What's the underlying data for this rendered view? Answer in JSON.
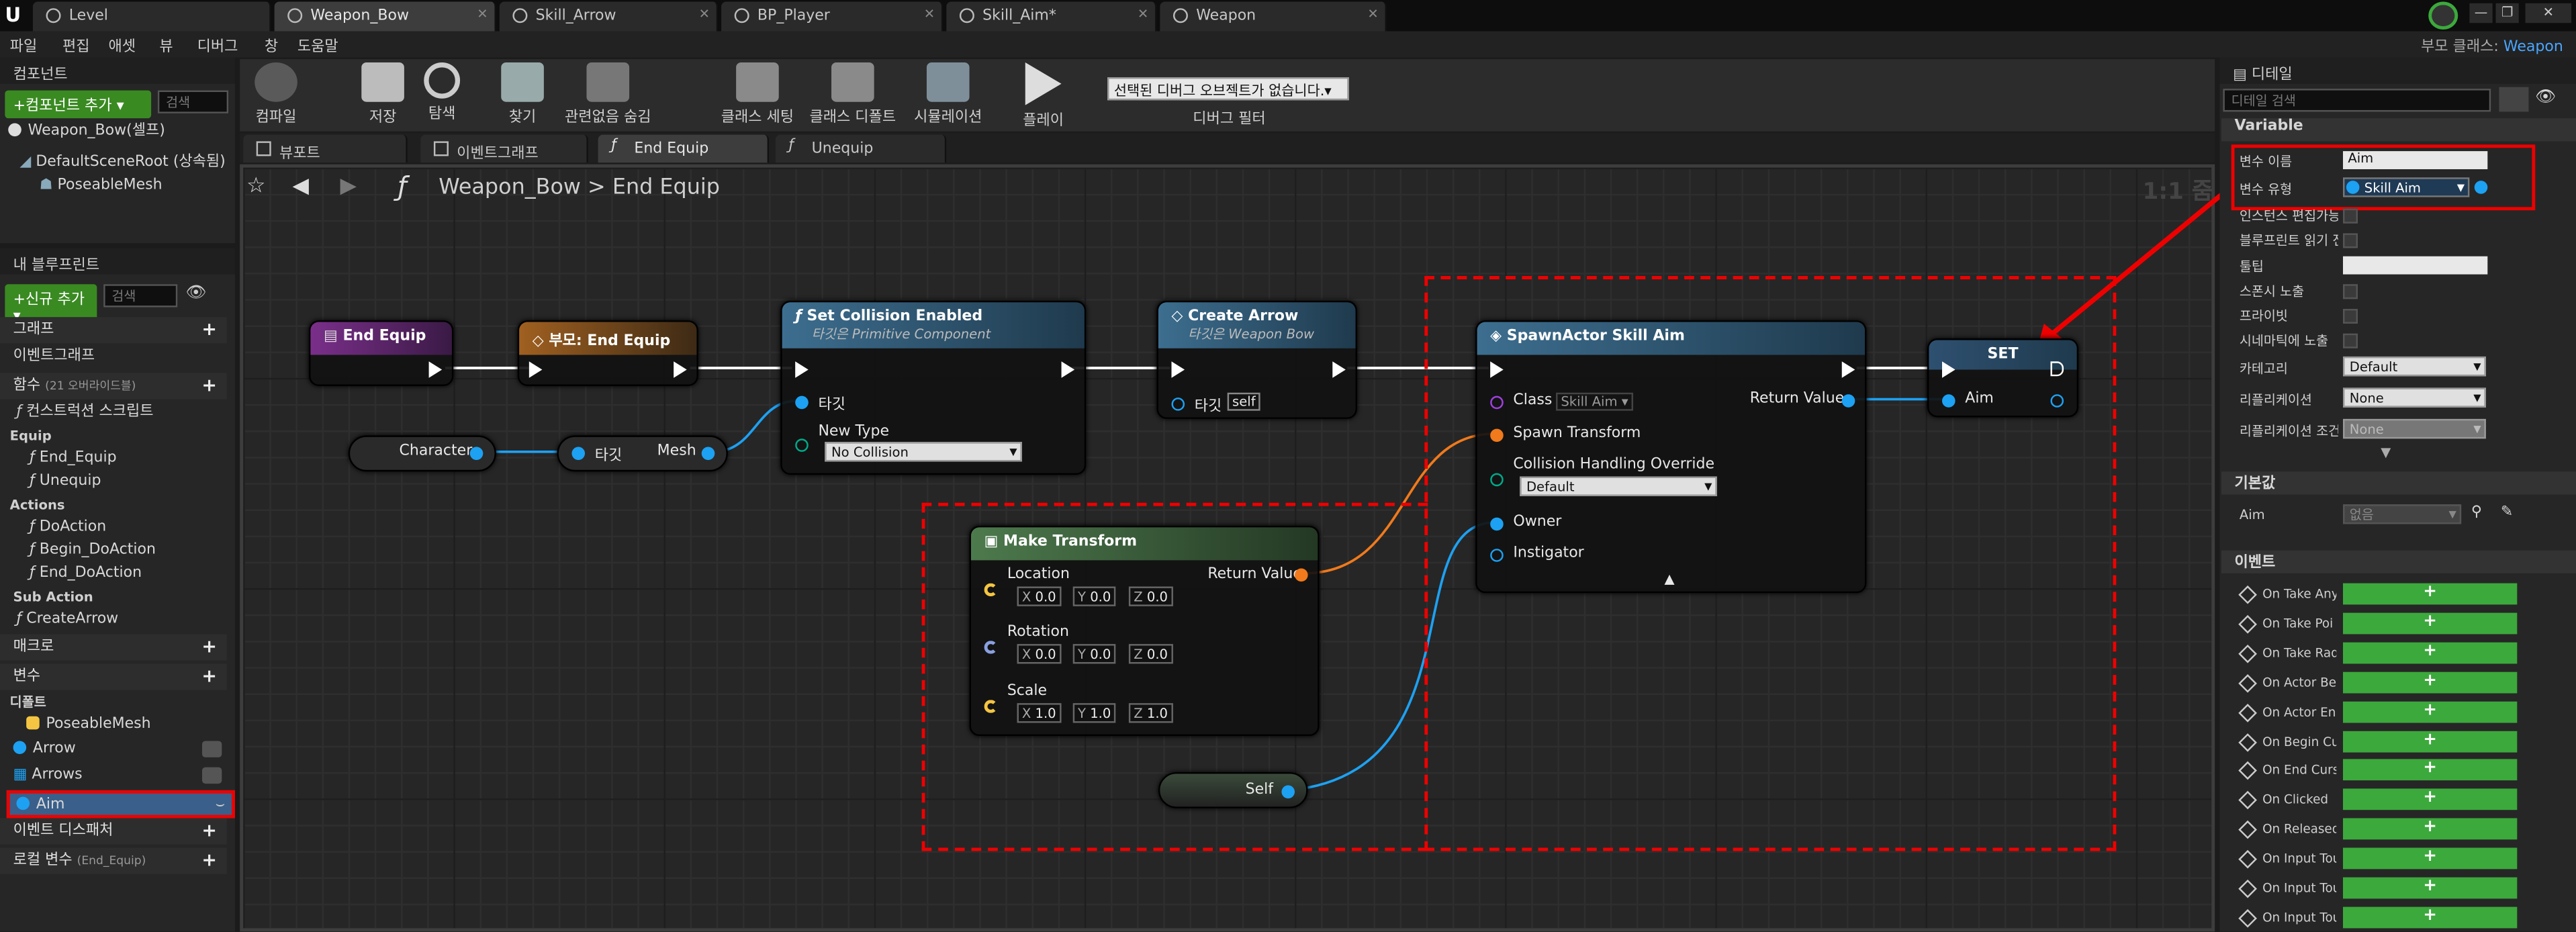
{
  "tabs": [
    "Level",
    "Weapon_Bow",
    "Skill_Arrow",
    "BP_Player",
    "Skill_Aim*",
    "Weapon"
  ],
  "menu": [
    "파일",
    "편집",
    "애셋",
    "뷰",
    "디버그",
    "창",
    "도움말"
  ],
  "parent_class_label": "부모 클래스:",
  "parent_class": "Weapon",
  "components": {
    "title": "컴포넌트",
    "add": "+컴포넌트 추가 ▾",
    "search": "검색",
    "items": [
      "Weapon_Bow(셀프)",
      "DefaultSceneRoot (상속됨)",
      "PoseableMesh"
    ]
  },
  "myblueprint": {
    "title": "내 블루프린트",
    "add": "+신규 추가 ▾",
    "search": "검색",
    "graphs": "그래프",
    "eventgraph": "이벤트그래프",
    "functions": "함수",
    "functions_count": "(21 오버라이드블)",
    "construction": "컨스트럭션 스크립트",
    "equip": "Equip",
    "equip_items": [
      "End_Equip",
      "Unequip"
    ],
    "actions": "Actions",
    "action_items": [
      "DoAction",
      "Begin_DoAction",
      "End_DoAction"
    ],
    "subaction": "Sub Action",
    "subaction_items": [
      "CreateArrow"
    ],
    "macros": "매크로",
    "variables": "변수",
    "default": "디폴트",
    "vars": [
      "PoseableMesh",
      "Arrow",
      "Arrows",
      "Aim"
    ],
    "dispatchers": "이벤트 디스패처",
    "local": "로컬 변수",
    "local_sub": "(End_Equip)"
  },
  "toolbar": {
    "compile": "컴파일",
    "save": "저장",
    "browse": "탐색",
    "find": "찾기",
    "hide": "관련없음 숨김",
    "class_settings": "클래스 세팅",
    "class_defaults": "클래스 디폴트",
    "simulate": "시뮬레이션",
    "play": "플레이",
    "debug_select": "선택된 디버그 오브젝트가 없습니다.▾",
    "debug_filter": "디버그 필터"
  },
  "graphtabs": [
    "뷰포트",
    "이벤트그래프",
    "End Equip",
    "Unequip"
  ],
  "breadcrumb": {
    "bp": "Weapon_Bow",
    "fn": "End Equip",
    "zoom": "1:1 줌"
  },
  "nodes": {
    "end_equip": "End Equip",
    "parent_end": "부모: End Equip",
    "character": "Character",
    "target": "타깃",
    "mesh": "Mesh",
    "set_collision": "Set Collision Enabled",
    "set_collision_sub": "타깃은 Primitive Component",
    "sc_target": "타깃",
    "sc_newtype": "New Type",
    "sc_value": "No Collision",
    "create_arrow": "Create Arrow",
    "create_arrow_sub": "타깃은 Weapon Bow",
    "ca_target": "타깃",
    "ca_self": "self",
    "spawn": "SpawnActor Skill Aim",
    "sp_class": "Class",
    "sp_class_val": "Skill Aim ▾",
    "sp_return": "Return Value",
    "sp_spawn_tf": "Spawn Transform",
    "sp_collision": "Collision Handling Override",
    "sp_collision_val": "Default",
    "sp_owner": "Owner",
    "sp_instigator": "Instigator",
    "set": "SET",
    "set_aim": "Aim",
    "make_tf": "Make Transform",
    "mt_location": "Location",
    "mt_rotation": "Rotation",
    "mt_scale": "Scale",
    "mt_return": "Return Value",
    "loc": [
      "0.0",
      "0.0",
      "0.0"
    ],
    "rot": [
      "0.0",
      "0.0",
      "0.0"
    ],
    "scl": [
      "1.0",
      "1.0",
      "1.0"
    ],
    "self": "Self"
  },
  "details": {
    "title": "디테일",
    "search": "디테일 검색",
    "variable": "Variable",
    "var_name_lbl": "변수 이름",
    "var_name": "Aim",
    "var_type_lbl": "변수 유형",
    "var_type": "Skill Aim",
    "rows": [
      "인스턴스 편집가능",
      "블루프린트 읽기 전",
      "툴팁",
      "스폰시 노출",
      "프라이빗",
      "시네마틱에 노출",
      "카테고리",
      "리플리케이션",
      "리플리케이션 조건"
    ],
    "category": "Default",
    "replication": "None",
    "rep_cond": "None",
    "defaults": "기본값",
    "aim_lbl": "Aim",
    "aim_val": "없음",
    "events": "이벤트",
    "event_items": [
      "On Take Any",
      "On Take Poi",
      "On Take Rad",
      "On Actor Be",
      "On Actor En",
      "On Begin Cu",
      "On End Curs",
      "On Clicked",
      "On Released",
      "On Input Tou",
      "On Input Tou",
      "On Input Tou"
    ]
  }
}
